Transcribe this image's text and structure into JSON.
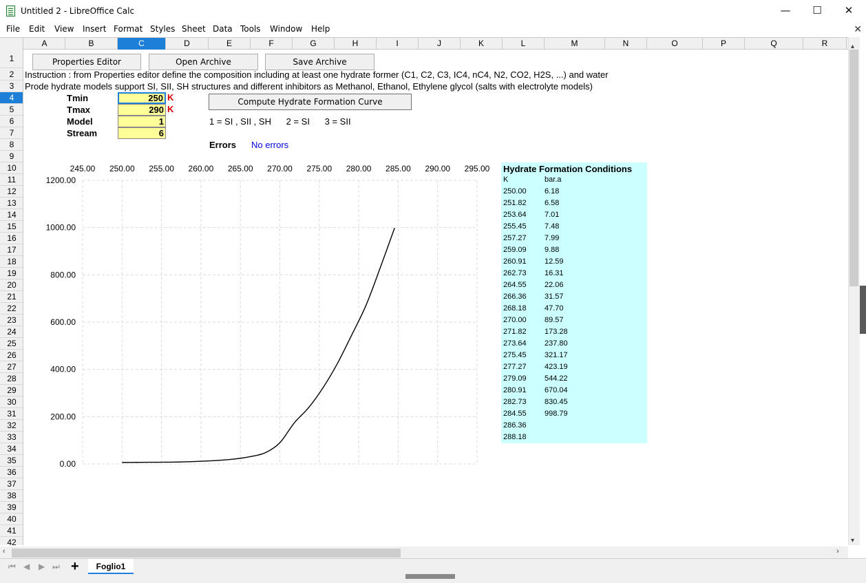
{
  "window": {
    "title": "Untitled 2 - LibreOffice Calc",
    "minimize": "—",
    "maximize": "☐",
    "close": "✕"
  },
  "menu": [
    "File",
    "Edit",
    "View",
    "Insert",
    "Format",
    "Styles",
    "Sheet",
    "Data",
    "Tools",
    "Window",
    "Help"
  ],
  "columns": [
    "A",
    "B",
    "C",
    "D",
    "E",
    "F",
    "G",
    "H",
    "I",
    "J",
    "K",
    "L",
    "M",
    "N",
    "O",
    "P",
    "Q",
    "R"
  ],
  "rows": [
    "1",
    "2",
    "3",
    "4",
    "5",
    "6",
    "7",
    "8",
    "9",
    "10",
    "11",
    "12",
    "13",
    "14",
    "15",
    "16",
    "17",
    "18",
    "19",
    "20",
    "21",
    "22",
    "23",
    "24",
    "25",
    "26",
    "27",
    "28",
    "29",
    "30",
    "31",
    "32",
    "33",
    "34",
    "35",
    "36",
    "37",
    "38",
    "39",
    "40",
    "41",
    "42"
  ],
  "buttons": {
    "properties_editor": "Properties Editor",
    "open_archive": "Open Archive",
    "save_archive": "Save Archive",
    "compute": "Compute Hydrate Formation Curve"
  },
  "instructions": {
    "line1": "Instruction : from Properties editor define the composition including at least one hydrate former (C1, C2, C3, IC4, nC4, N2, CO2, H2S, ...) and water",
    "line2": "Prode hydrate models support SI, SII, SH structures and  different inhibitors as Methanol, Ethanol, Ethylene glycol (salts with electrolyte models)"
  },
  "inputs": {
    "tmin_label": "Tmin",
    "tmin_value": "250",
    "tmin_unit": "K",
    "tmax_label": "Tmax",
    "tmax_value": "290",
    "tmax_unit": "K",
    "model_label": "Model",
    "model_value": "1",
    "stream_label": "Stream",
    "stream_value": "6"
  },
  "model_legend": "1 = SI , SII , SH      2 = SI      3 = SII",
  "errors": {
    "label": "Errors",
    "value": "No errors"
  },
  "results": {
    "title": "Hydrate Formation Conditions",
    "col_k": "K",
    "col_bar": "bar.a",
    "K": [
      "250.00",
      "251.82",
      "253.64",
      "255.45",
      "257.27",
      "259.09",
      "260.91",
      "262.73",
      "264.55",
      "266.36",
      "268.18",
      "270.00",
      "271.82",
      "273.64",
      "275.45",
      "277.27",
      "279.09",
      "280.91",
      "282.73",
      "284.55",
      "286.36",
      "288.18"
    ],
    "bar": [
      "6.18",
      "6.58",
      "7.01",
      "7.48",
      "7.99",
      "9.88",
      "12.59",
      "16.31",
      "22.06",
      "31.57",
      "47.70",
      "89.57",
      "173.28",
      "237.80",
      "321.17",
      "423.19",
      "544.22",
      "670.04",
      "830.45",
      "998.79",
      "",
      ""
    ]
  },
  "chart_data": {
    "type": "line",
    "xlim": [
      245,
      295
    ],
    "ylim": [
      0,
      1200
    ],
    "x_ticks": [
      "245.00",
      "250.00",
      "255.00",
      "260.00",
      "265.00",
      "270.00",
      "275.00",
      "280.00",
      "285.00",
      "290.00",
      "295.00"
    ],
    "y_ticks": [
      "1200.00",
      "1000.00",
      "800.00",
      "600.00",
      "400.00",
      "200.00",
      "0.00"
    ],
    "x_axis_position": "top",
    "grid": "dashed",
    "series": [
      {
        "x": [
          250.0,
          251.82,
          253.64,
          255.45,
          257.27,
          259.09,
          260.91,
          262.73,
          264.55,
          266.36,
          268.18,
          270.0,
          271.82,
          273.64,
          275.45,
          277.27,
          279.09,
          280.91,
          282.73,
          284.55
        ],
        "y": [
          6.18,
          6.58,
          7.01,
          7.48,
          7.99,
          9.88,
          12.59,
          16.31,
          22.06,
          31.57,
          47.7,
          89.57,
          173.28,
          237.8,
          321.17,
          423.19,
          544.22,
          670.04,
          830.45,
          998.79
        ],
        "color": "#000000"
      }
    ]
  },
  "sheet_tab": "Foglio1",
  "colors": {
    "selection": "#1e7fd8",
    "input_fill": "#ffff99",
    "results_fill": "#ccffff",
    "unit_red": "#e00000",
    "error_blue": "#0000dd"
  }
}
